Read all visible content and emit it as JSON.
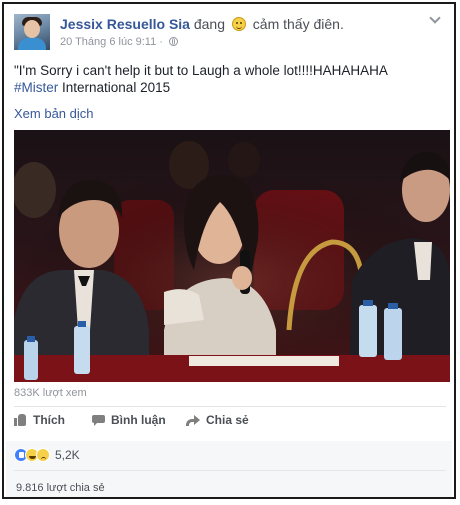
{
  "post": {
    "author": "Jessix Resuello Sia",
    "feeling_prefix": "đang",
    "feeling": "cảm thấy điên.",
    "timestamp": "20 Tháng 6 lúc 9:11 ·",
    "text_main": "\"I'm Sorry i can't help it but to Laugh a whole lot!!!!HAHAHAHA",
    "hashtag": "#Mister",
    "text_tail": " International 2015",
    "translate_link": "Xem bản dịch"
  },
  "video": {
    "views": "833K lượt xem"
  },
  "actions": {
    "like_label": "Thích",
    "comment_label": "Bình luận",
    "share_label": "Chia sẻ"
  },
  "stats": {
    "reaction_count": "5,2K",
    "shares": "9.816 lượt chia sẻ"
  },
  "icons": {
    "feeling": "grin-face-icon",
    "privacy": "globe-icon",
    "menu": "chevron-down-icon",
    "reactions": [
      "like-reaction-icon",
      "haha-reaction-icon",
      "sad-reaction-icon"
    ]
  },
  "colors": {
    "link": "#365899",
    "meta": "#90949c",
    "like_blue": "#4080ff",
    "footer_bg": "#f6f7f9"
  }
}
